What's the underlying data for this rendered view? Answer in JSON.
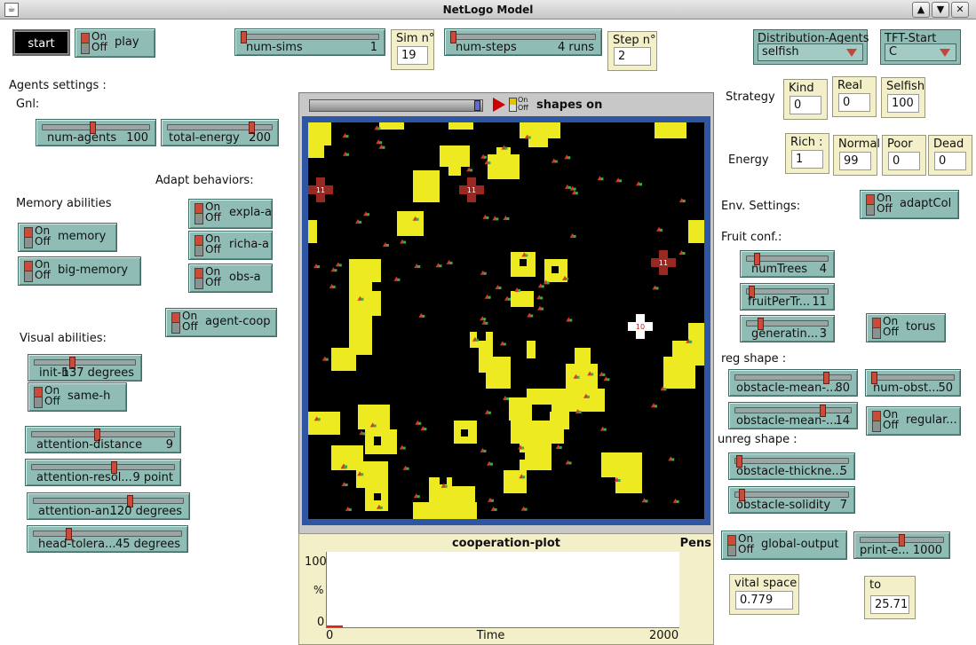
{
  "window": {
    "title": "NetLogo Model"
  },
  "buttons": {
    "start": "start"
  },
  "switches": [
    {
      "name": "play",
      "on": "On",
      "off": "Off"
    },
    {
      "name": "expla-a",
      "on": "On",
      "off": "Off"
    },
    {
      "name": "memory",
      "on": "On",
      "off": "Off"
    },
    {
      "name": "richa-a",
      "on": "On",
      "off": "Off"
    },
    {
      "name": "big-memory",
      "on": "On",
      "off": "Off"
    },
    {
      "name": "obs-a",
      "on": "On",
      "off": "Off"
    },
    {
      "name": "agent-coop",
      "on": "On",
      "off": "Off"
    },
    {
      "name": "same-h",
      "on": "On",
      "off": "Off"
    },
    {
      "name": "adaptCol",
      "on": "On",
      "off": "Off"
    },
    {
      "name": "torus",
      "on": "On",
      "off": "Off"
    },
    {
      "name": "regular...",
      "on": "On",
      "off": "Off"
    },
    {
      "name": "global-output",
      "on": "On",
      "off": "Off"
    }
  ],
  "sliders": [
    {
      "name": "num-sims",
      "value": "1",
      "fraction": 0.0
    },
    {
      "name": "num-steps",
      "value": "4 runs",
      "fraction": 0.0
    },
    {
      "name": "num-agents",
      "value": "100",
      "fraction": 0.47
    },
    {
      "name": "total-energy",
      "value": "200",
      "fraction": 0.82
    },
    {
      "name": "init-h",
      "value": "137 degrees",
      "fraction": 0.37
    },
    {
      "name": "attention-distance",
      "value": "9",
      "fraction": 0.46
    },
    {
      "name": "attention-resol...",
      "value": "9 point",
      "fraction": 0.58
    },
    {
      "name": "attention-an...",
      "value": "120 degrees",
      "fraction": 0.65
    },
    {
      "name": "head-tolera...",
      "value": "45 degrees",
      "fraction": 0.23
    },
    {
      "name": "numTrees",
      "value": "4",
      "fraction": 0.11
    },
    {
      "name": "fruitPerTr...",
      "value": "11",
      "fraction": 0.04
    },
    {
      "name": "generatin...",
      "value": "3",
      "fraction": 0.15
    },
    {
      "name": "obstacle-mean-...",
      "value": "80",
      "fraction": 0.8
    },
    {
      "name": "num-obst...",
      "value": "50",
      "fraction": 0.0
    },
    {
      "name": "obstacle-mean-...",
      "value": "14",
      "fraction": 0.77
    },
    {
      "name": "obstacle-thickne...",
      "value": "5",
      "fraction": 0.02
    },
    {
      "name": "obstacle-solidity",
      "value": "7",
      "fraction": 0.04
    },
    {
      "name": "print-e...",
      "value": "1000",
      "fraction": 0.5
    }
  ],
  "monitors": [
    {
      "name": "Sim n°",
      "value": "19"
    },
    {
      "name": "Step n°",
      "value": "2"
    },
    {
      "name": "Kind",
      "value": "0"
    },
    {
      "name": "Real",
      "value": "0"
    },
    {
      "name": "Selfish",
      "value": "100"
    },
    {
      "name": "Rich :",
      "value": "1"
    },
    {
      "name": "Normal",
      "value": "99"
    },
    {
      "name": "Poor",
      "value": "0"
    },
    {
      "name": "Dead",
      "value": "0"
    },
    {
      "name": "vital space",
      "value": "0.779"
    },
    {
      "name": "to",
      "value": "25.717"
    }
  ],
  "choosers": [
    {
      "name": "Distribution-Agents",
      "value": "selfish"
    },
    {
      "name": "TFT-Start",
      "value": "C"
    }
  ],
  "labels": {
    "agents_settings": "Agents settings :",
    "gnl": "Gnl:",
    "adapt_behaviors": "Adapt behaviors:",
    "memory_abilities": "Memory abilities",
    "visual_abilities": "Visual abilities:",
    "strategy": "Strategy",
    "energy": "Energy",
    "env_settings": "Env. Settings:",
    "fruit_conf": "Fruit conf.:",
    "reg_shape": "reg shape :",
    "unreg_shape": "unreg shape :"
  },
  "view": {
    "shapes_label": "shapes on",
    "on": "On",
    "off": "Off"
  },
  "plot": {
    "title": "cooperation-plot",
    "pens_label": "Pens",
    "ymax": "100",
    "ymin": "0",
    "xmin": "0",
    "xmax": "2000",
    "xlabel": "Time",
    "ylabel": "%"
  },
  "markers": [
    {
      "label": "11"
    },
    {
      "label": "11"
    },
    {
      "label": "11"
    },
    {
      "label": "10"
    }
  ]
}
